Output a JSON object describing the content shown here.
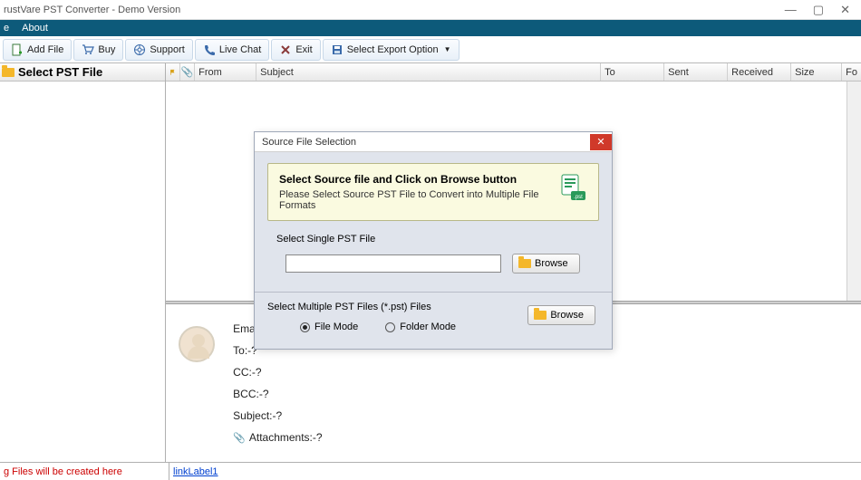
{
  "app": {
    "title": "rustVare PST Converter - Demo Version"
  },
  "menu": {
    "file": "e",
    "about": "About"
  },
  "toolbar": {
    "add_file": "Add File",
    "buy": "Buy",
    "support": "Support",
    "live_chat": "Live Chat",
    "exit": "Exit",
    "export": "Select Export Option"
  },
  "left": {
    "header": "Select PST File"
  },
  "grid": {
    "cols": {
      "from": "From",
      "subject": "Subject",
      "to": "To",
      "sent": "Sent",
      "received": "Received",
      "size": "Size",
      "folder": "Fo"
    }
  },
  "detail": {
    "email": "Email Ad",
    "to": "To:-?",
    "cc": "CC:-?",
    "bcc": "BCC:-?",
    "subject": "Subject:-?",
    "attachments": "Attachments:-?"
  },
  "status": {
    "log": "g Files will be created here",
    "link": "linkLabel1"
  },
  "modal": {
    "title": "Source File Selection",
    "info_head": "Select Source file and Click on Browse button",
    "info_sub": "Please Select Source PST File to Convert into Multiple File Formats",
    "single_label": "Select Single PST File",
    "browse": "Browse",
    "multi_label": "Select Multiple PST Files (*.pst) Files",
    "file_mode": "File Mode",
    "folder_mode": "Folder Mode"
  }
}
